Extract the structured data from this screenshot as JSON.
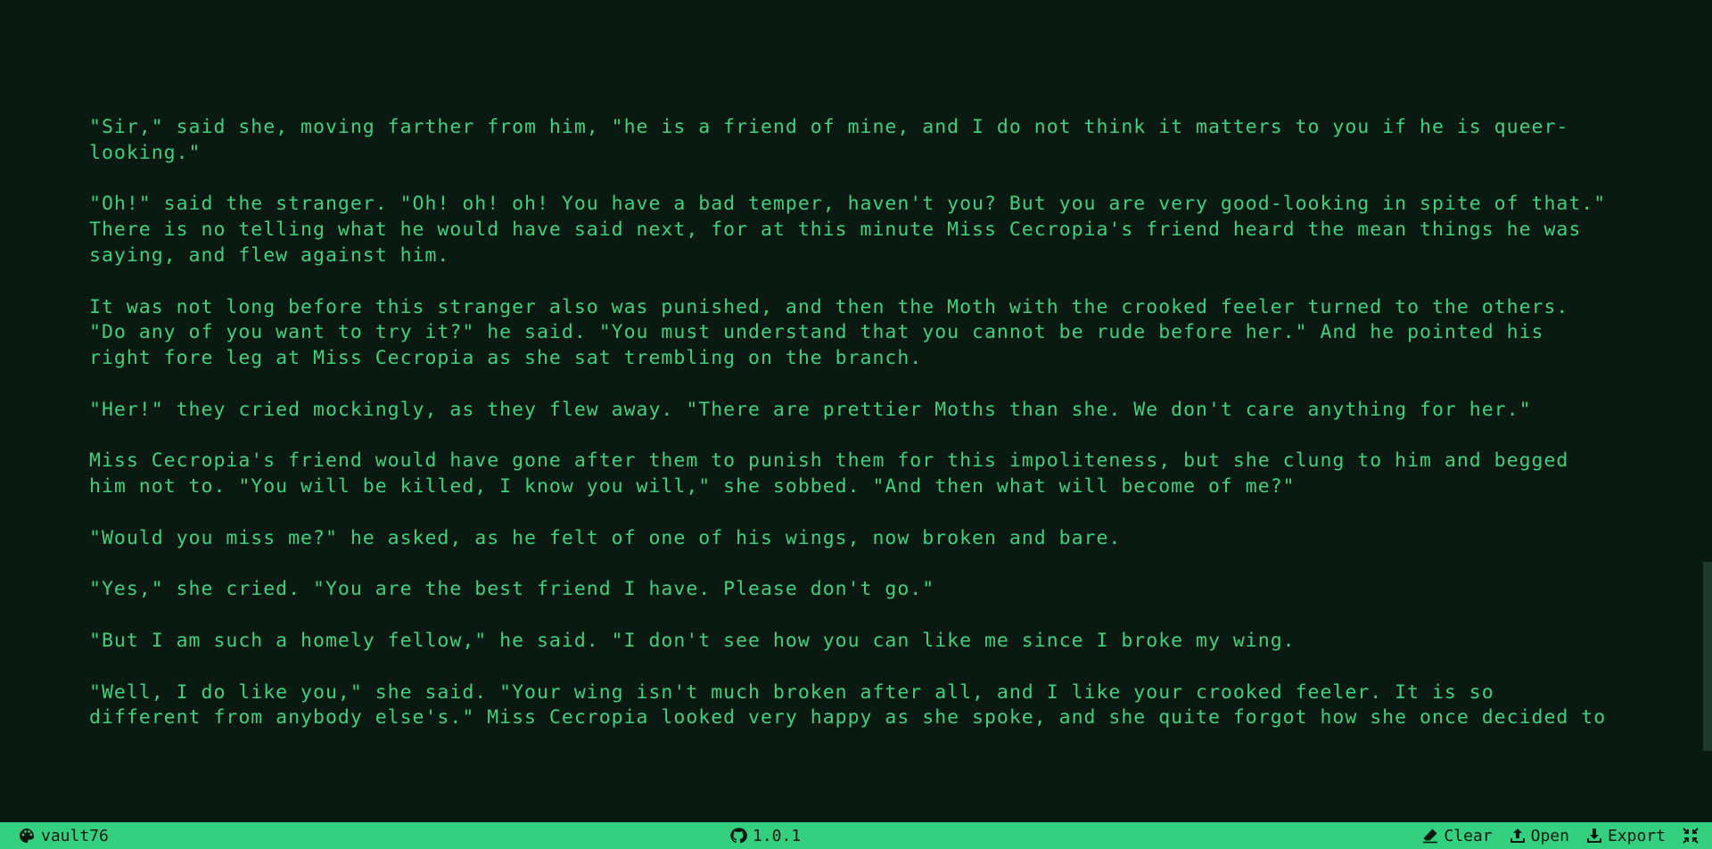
{
  "document": {
    "paragraphs": [
      {
        "lines": [
          "\"Sir,\" said she, moving farther from him, \"he is a friend of mine, and I do not think it matters to you if he is queer-",
          "looking.\""
        ]
      },
      {
        "lines": [
          "\"Oh!\" said the stranger. \"Oh! oh! oh! You have a bad temper, haven't you? But you are very good-looking in spite of that.\"",
          "There is no telling what he would have said next, for at this minute Miss Cecropia's friend heard the mean things he was",
          "saying, and flew against him."
        ]
      },
      {
        "lines": [
          "It was not long before this stranger also was punished, and then the Moth with the crooked feeler turned to the others.",
          "\"Do any of you want to try it?\" he said. \"You must understand that you cannot be rude before her.\" And he pointed his",
          "right fore leg at Miss Cecropia as she sat trembling on the branch."
        ]
      },
      {
        "lines": [
          "\"Her!\" they cried mockingly, as they flew away. \"There are prettier Moths than she. We don't care anything for her.\""
        ]
      },
      {
        "lines": [
          "Miss Cecropia's friend would have gone after them to punish them for this impoliteness, but she clung to him and begged",
          "him not to. \"You will be killed, I know you will,\" she sobbed. \"And then what will become of me?\""
        ]
      },
      {
        "lines": [
          "\"Would you miss me?\" he asked, as he felt of one of his wings, now broken and bare."
        ]
      },
      {
        "lines": [
          "\"Yes,\" she cried. \"You are the best friend I have. Please don't go.\""
        ]
      },
      {
        "lines": [
          "\"But I am such a homely fellow,\" he said. \"I don't see how you can like me since I broke my wing."
        ]
      },
      {
        "lines": [
          "\"Well, I do like you,\" she said. \"Your wing isn't much broken after all, and I like your crooked feeler. It is so",
          "different from anybody else's.\" Miss Cecropia looked very happy as she spoke, and she quite forgot how she once decided to"
        ]
      }
    ]
  },
  "statusbar": {
    "theme_icon": "palette-icon",
    "theme_name": "vault76",
    "version_icon": "github-icon",
    "version": "1.0.1",
    "clear_icon": "eraser-icon",
    "clear_label": "Clear",
    "open_icon": "upload-icon",
    "open_label": "Open",
    "export_icon": "download-icon",
    "export_label": "Export",
    "fullscreen_icon": "exit-fullscreen-icon"
  },
  "colors": {
    "background": "#0a1a12",
    "text": "#3fd07d",
    "statusbar_bg": "#35d07f",
    "statusbar_text": "#0a1a12",
    "scrollbar": "#1e3a2a"
  }
}
